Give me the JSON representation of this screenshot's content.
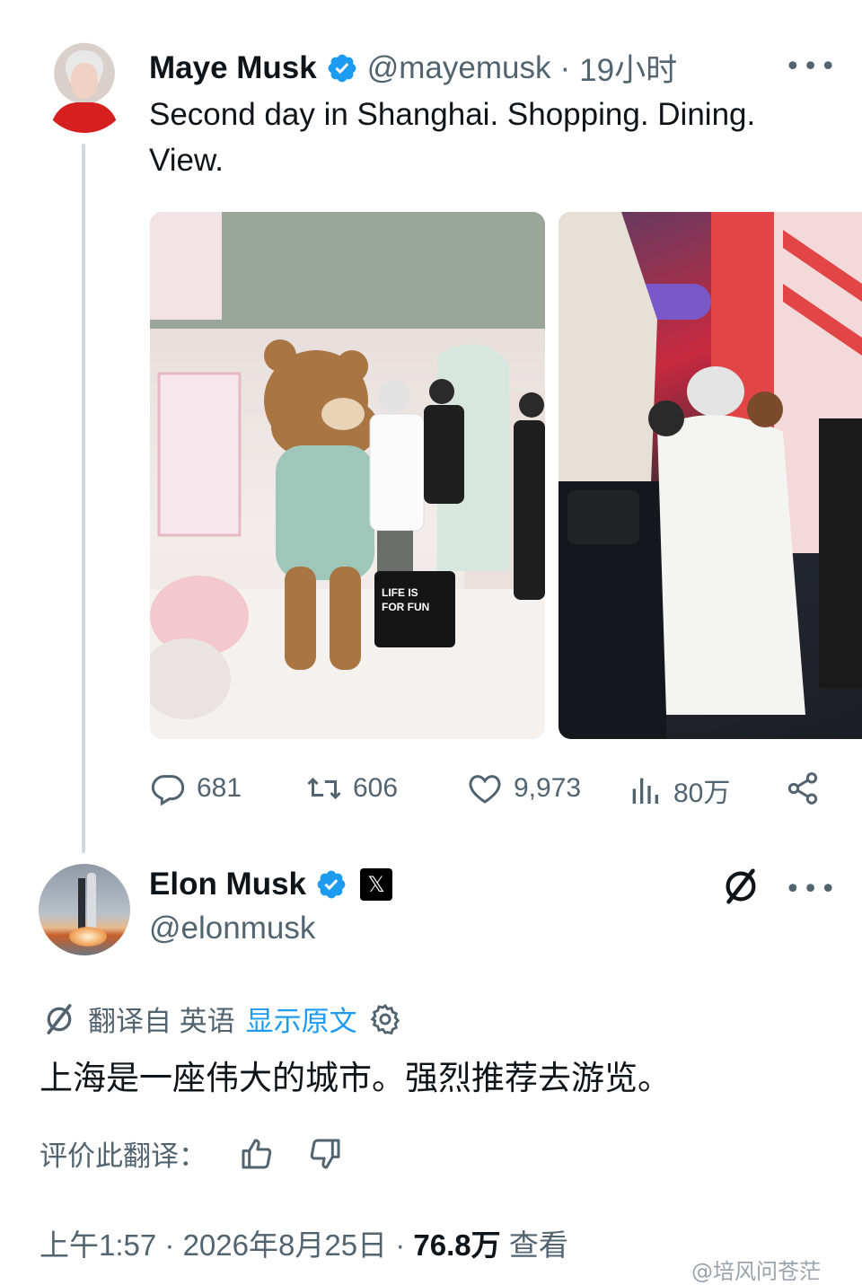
{
  "parent_tweet": {
    "author_name": "Maye Musk",
    "handle": "@mayemusk",
    "time": "19小时",
    "separator": "·",
    "text_line1": "Second day in Shanghai. Shopping. Dining.",
    "text_line2": "View.",
    "photo1_labels": [
      "LIFE IS FOR FUN"
    ],
    "stats": {
      "replies": "681",
      "reposts": "606",
      "likes": "9,973",
      "views": "80万"
    }
  },
  "reply_tweet": {
    "author_name": "Elon Musk",
    "handle": "@elonmusk",
    "affiliate_badge": "𝕏",
    "translation": {
      "prefix": "翻译自 英语",
      "show_original": "显示原文"
    },
    "text": "上海是一座伟大的城市。强烈推荐去游览。",
    "rate_prompt": "评价此翻译：",
    "footer": {
      "time": "上午1:57",
      "date": "2026年8月25日",
      "views_count": "76.8万",
      "views_label": "查看"
    }
  },
  "watermark": "@培风问苍茫",
  "colors": {
    "verified_blue": "#1d9bf0",
    "text": "#0f1419",
    "muted": "#536471",
    "thread_line": "#cfd9de"
  },
  "icons": [
    "reply-icon",
    "repost-icon",
    "like-icon",
    "views-icon",
    "share-icon",
    "grok-icon",
    "translate-icon",
    "gear-icon",
    "thumbs-up-icon",
    "thumbs-down-icon",
    "more-icon",
    "verified-icon"
  ]
}
